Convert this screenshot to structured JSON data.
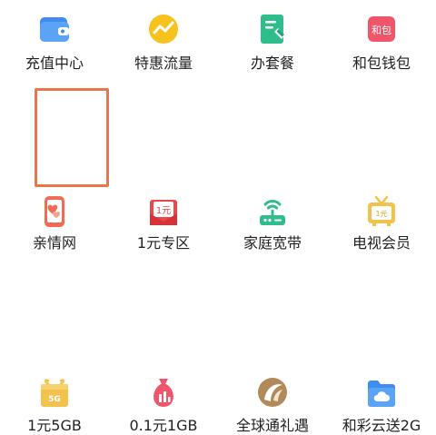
{
  "colors": {
    "selection_border": "#e8764a",
    "blue": "#3d8ef0",
    "yellow": "#f6c21b",
    "green": "#2fbd8c",
    "pink": "#f0566b",
    "red": "#e9474a",
    "gold": "#f3c24c",
    "brown": "#b08a58"
  },
  "services": [
    {
      "label": "充值中心",
      "icon": "wallet-icon"
    },
    {
      "label": "特惠流量",
      "icon": "traffic-trend-icon"
    },
    {
      "label": "办套餐",
      "icon": "plan-edit-icon"
    },
    {
      "label": "和包钱包",
      "icon": "hebao-wallet-icon",
      "icon_text": "和包"
    },
    {
      "label": "亲情网",
      "icon": "family-phone-icon",
      "selected": true
    },
    {
      "label": "1元专区",
      "icon": "red-envelope-icon",
      "icon_text": "1元"
    },
    {
      "label": "家庭宽带",
      "icon": "router-icon"
    },
    {
      "label": "电视会员",
      "icon": "tv-icon",
      "icon_text": "1元"
    },
    {
      "label": "1元5GB",
      "icon": "gift-5g-icon",
      "icon_text": "5G"
    },
    {
      "label": "0.1元1GB",
      "icon": "money-bag-icon"
    },
    {
      "label": "全球通礼遇",
      "icon": "global-logo-icon"
    },
    {
      "label": "和彩云送2G",
      "icon": "cloud-folder-icon"
    }
  ]
}
